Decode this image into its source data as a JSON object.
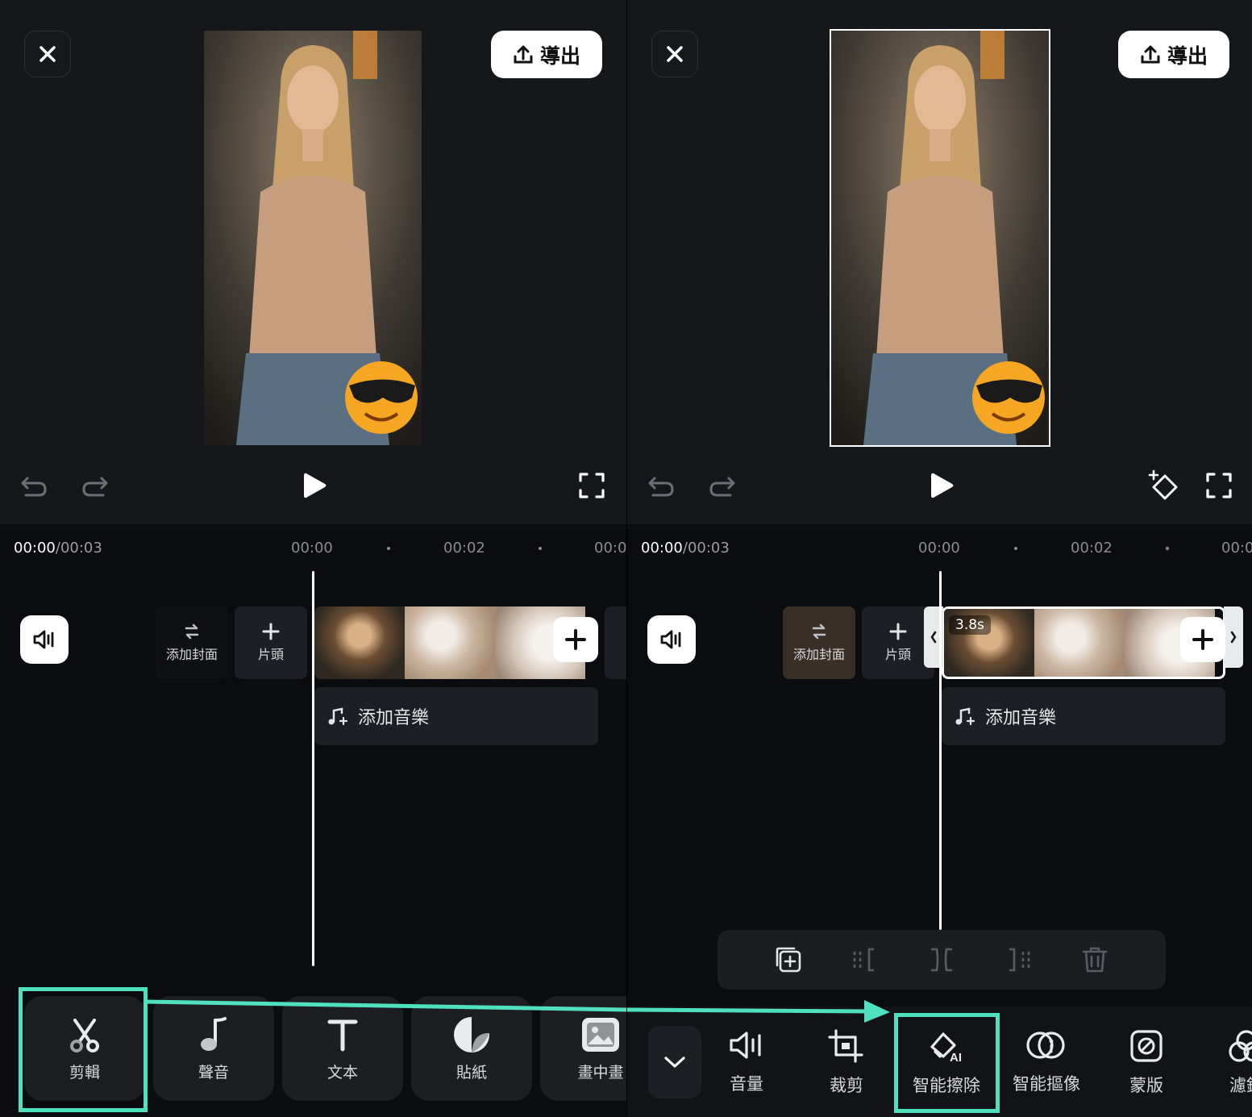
{
  "left": {
    "export_label": "導出",
    "time_current": "00:00",
    "time_total": "/00:03",
    "ticks": [
      "00:00",
      "00:02",
      "00:0"
    ],
    "cover_label": "添加封面",
    "intro_label": "片頭",
    "music_label": "添加音樂",
    "tools": [
      {
        "label": "剪輯",
        "icon": "scissors-icon"
      },
      {
        "label": "聲音",
        "icon": "music-note-icon"
      },
      {
        "label": "文本",
        "icon": "text-icon"
      },
      {
        "label": "貼紙",
        "icon": "sticker-icon"
      },
      {
        "label": "畫中畫",
        "icon": "picture-in-picture-icon"
      }
    ]
  },
  "right": {
    "export_label": "導出",
    "time_current": "00:00",
    "time_total": "/00:03",
    "ticks": [
      "00:00",
      "00:02",
      "00:0"
    ],
    "cover_label": "添加封面",
    "intro_label": "片頭",
    "clip_duration": "3.8s",
    "music_label": "添加音樂",
    "tools": [
      {
        "label": "音量",
        "icon": "volume-icon"
      },
      {
        "label": "裁剪",
        "icon": "crop-icon"
      },
      {
        "label": "智能擦除",
        "icon": "ai-eraser-icon"
      },
      {
        "label": "智能摳像",
        "icon": "ai-cutout-icon"
      },
      {
        "label": "蒙版",
        "icon": "mask-icon"
      },
      {
        "label": "濾鏡",
        "icon": "filter-icon"
      }
    ]
  },
  "colors": {
    "highlight": "#4fe0bf",
    "background": "#0b0c0f",
    "panel": "#15171b"
  }
}
